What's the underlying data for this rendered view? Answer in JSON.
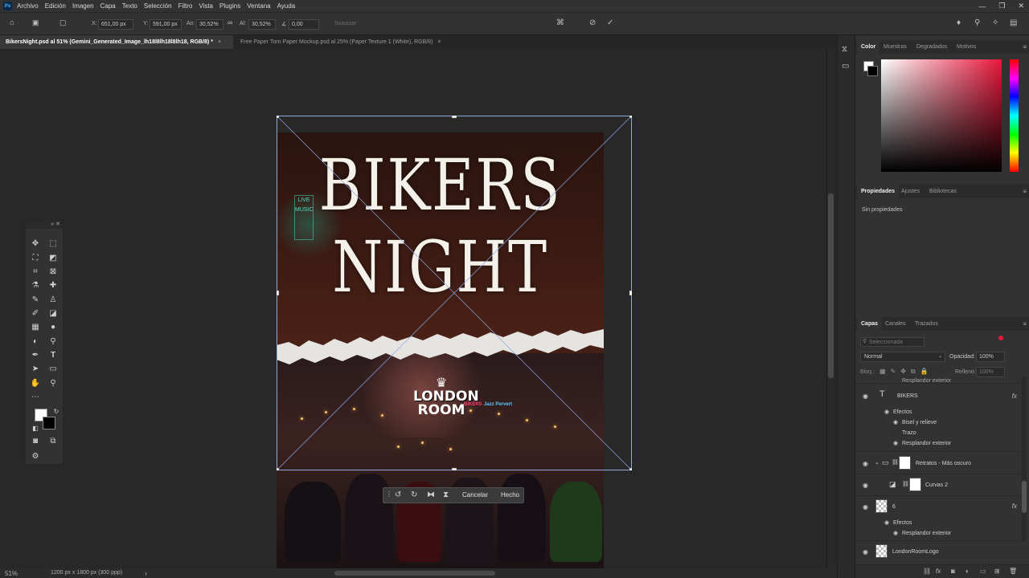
{
  "menu": {
    "logo": "Ps",
    "items": [
      "Archivo",
      "Edición",
      "Imagen",
      "Capa",
      "Texto",
      "Selección",
      "Filtro",
      "Vista",
      "Plugins",
      "Ventana",
      "Ayuda"
    ]
  },
  "window_controls": {
    "minimize": "—",
    "restore": "❐",
    "close": "✕"
  },
  "options": {
    "x_label": "X:",
    "x_value": "651,00 px",
    "y_label": "Y:",
    "y_value": "591,00 px",
    "w_label": "An:",
    "w_value": "30,52%",
    "h_label": "Al:",
    "h_value": "30,52%",
    "angle_label": "∡",
    "angle_value": "0,00",
    "smooth_label": "Suavizar"
  },
  "tabs": [
    {
      "label": "BikersNight.psd al 51% (Gemini_Generated_Image_lh18l8lh18l8lh18, RGB/8) *",
      "close": "×"
    },
    {
      "label": "Free Paper Torn Paper Mockup.psd al 25% (Paper Texture 1 (White), RGB/8)",
      "close": "×"
    }
  ],
  "document": {
    "title_line1": "BIKERS",
    "title_line2": "NIGHT",
    "neon_sign": "LIVE MUSIC",
    "logo_line1": "LONDON",
    "logo_line2": "ROOM",
    "neon_text1": "BIKERS",
    "neon_text2": "Jazz Pervert"
  },
  "transform_bar": {
    "cancel": "Cancelar",
    "done": "Hecho"
  },
  "status": {
    "zoom": "51%",
    "doc_info": "1200 px x 1800 px (300 ppp)",
    "arrow": "›"
  },
  "color_panel": {
    "tabs": [
      "Color",
      "Muestras",
      "Degradados",
      "Motivos"
    ]
  },
  "properties_panel": {
    "tabs": [
      "Propiedades",
      "Ajustes",
      "Bibliotecas"
    ],
    "empty": "Sin propiedades"
  },
  "layers_panel": {
    "tabs": [
      "Capas",
      "Canales",
      "Trazados"
    ],
    "search_placeholder": "Seleccionada",
    "blend_mode": "Normal",
    "opacity_label": "Opacidad:",
    "opacity_value": "100%",
    "lock_label": "Bloq.:",
    "fill_label": "Relleno:",
    "fill_value": "100%",
    "partial_top": "Resplandor exterior",
    "layers": [
      {
        "name": "BIKERS",
        "type": "text",
        "fx": "fx"
      },
      {
        "name": "Efectos",
        "type": "effects-header"
      },
      {
        "name": "Bisel y relieve",
        "type": "effect",
        "visible": true
      },
      {
        "name": "Trazo",
        "type": "effect",
        "visible": false
      },
      {
        "name": "Resplandor exterior",
        "type": "effect",
        "visible": true
      },
      {
        "name": "Retratos - Más oscuro",
        "type": "group"
      },
      {
        "name": "Curvas 2",
        "type": "adjustment"
      },
      {
        "name": "6",
        "type": "smart",
        "fx": "fx"
      },
      {
        "name": "Efectos",
        "type": "effects-header"
      },
      {
        "name": "Resplandor exterior",
        "type": "effect",
        "visible": true
      },
      {
        "name": "LondonRoomLogo",
        "type": "smart"
      }
    ]
  },
  "colors": {
    "ui_bg": "#323232",
    "canvas_bg": "#282828",
    "accent_red": "#e8173b",
    "transform_box": "#8ea8e0"
  }
}
